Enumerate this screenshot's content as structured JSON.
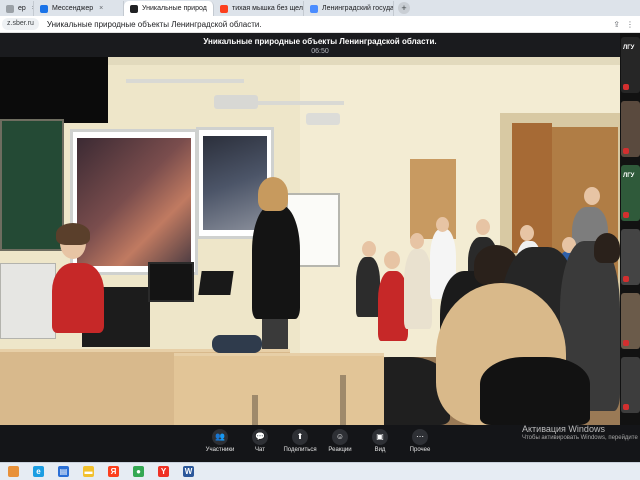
{
  "browser": {
    "tabs": [
      {
        "label": "ер",
        "icon": "page-icon",
        "color": "#9aa0a6"
      },
      {
        "label": "Мессенджер",
        "icon": "messenger-icon",
        "color": "#1a73e8"
      },
      {
        "label": "Уникальные природ",
        "icon": "sberjazz-icon",
        "color": "#202124",
        "active": true
      },
      {
        "label": "тихая мышка без щелчко",
        "icon": "yandex-icon",
        "color": "#fc3f1d"
      },
      {
        "label": "Ленинградский государс",
        "icon": "docs-icon",
        "color": "#4a8cff"
      }
    ],
    "new_tab": "+",
    "url": "z.sber.ru",
    "page_title": "Уникальные природные объекты Ленинградской области."
  },
  "meeting": {
    "title": "Уникальные природные объекты Ленинградской области.",
    "elapsed": "06:50"
  },
  "thumbnails": [
    {
      "label": "ЛГУ",
      "color": "#262626"
    },
    {
      "label": "",
      "color": "#5a4a3e"
    },
    {
      "label": "ЛГУ",
      "color": "#2f5a3a"
    },
    {
      "label": "",
      "color": "#444444"
    },
    {
      "label": "",
      "color": "#6b5b4a"
    },
    {
      "label": "",
      "color": "#3d3d3d"
    }
  ],
  "controls": [
    {
      "label": "Участники",
      "icon": "participants-icon",
      "glyph": "👥"
    },
    {
      "label": "Чат",
      "icon": "chat-icon",
      "glyph": "💬"
    },
    {
      "label": "Поделиться",
      "icon": "share-screen-icon",
      "glyph": "⬆"
    },
    {
      "label": "Реакции",
      "icon": "reactions-icon",
      "glyph": "☺"
    },
    {
      "label": "Вид",
      "icon": "view-icon",
      "glyph": "▣"
    },
    {
      "label": "Прочее",
      "icon": "more-icon",
      "glyph": "⋯"
    }
  ],
  "windows_activation": {
    "title": "Активация Windows",
    "subtitle": "Чтобы активировать Windows, перейдите"
  },
  "taskbar": [
    {
      "icon": "widgets-icon",
      "color": "#e8913a",
      "glyph": ""
    },
    {
      "icon": "edge-icon",
      "color": "#1b9de2",
      "glyph": "e"
    },
    {
      "icon": "store-icon",
      "color": "#2a6fd6",
      "glyph": "▤"
    },
    {
      "icon": "explorer-icon",
      "color": "#f2c12e",
      "glyph": "▬"
    },
    {
      "icon": "yandex-browser-icon",
      "color": "#fc3f1d",
      "glyph": "Я"
    },
    {
      "icon": "chrome-icon",
      "color": "#34a853",
      "glyph": "●"
    },
    {
      "icon": "yandex-icon",
      "color": "#ef3124",
      "glyph": "Y"
    },
    {
      "icon": "word-icon",
      "color": "#2b579a",
      "glyph": "W"
    }
  ]
}
